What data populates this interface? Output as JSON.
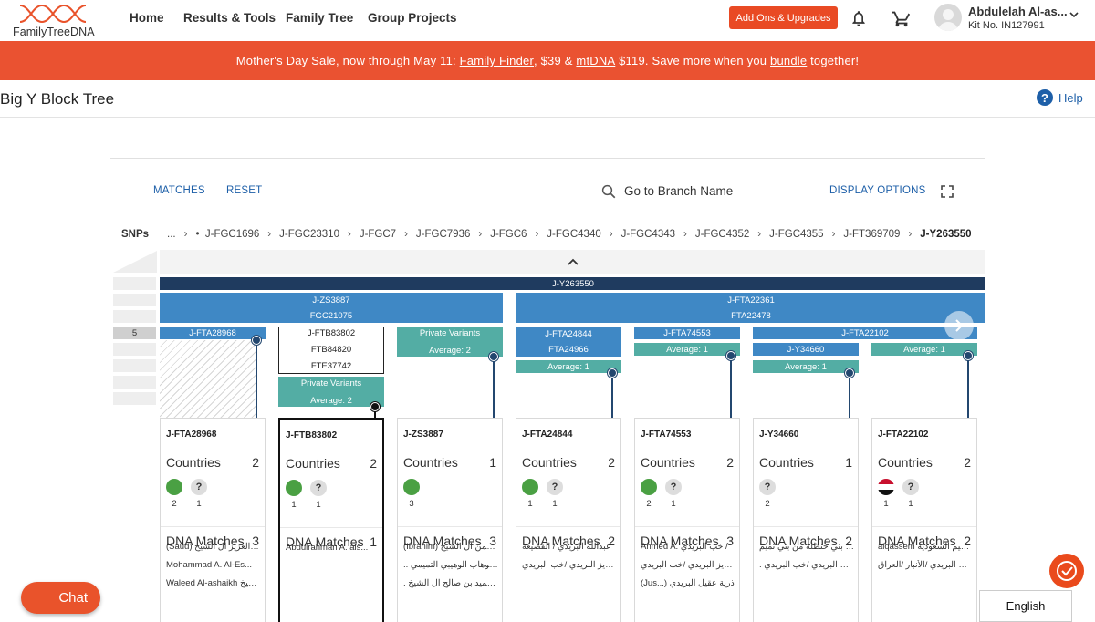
{
  "header": {
    "logo_text": "FamilyTreeDNA",
    "nav": [
      "Home",
      "Results & Tools",
      "Family Tree",
      "Group Projects"
    ],
    "addons_label": "Add Ons & Upgrades",
    "user_name": "Abdulelah Al-as...",
    "user_kit": "Kit No. IN127991"
  },
  "banner": {
    "prefix": "Mother's Day Sale, now through May 11: ",
    "link1": "Family Finder",
    "mid1": ", $39 & ",
    "link2": "mtDNA",
    "mid2": " $119. Save more when you ",
    "link3": "bundle",
    "suffix": " together!"
  },
  "page": {
    "title": "Big Y Block Tree",
    "help_label": "Help"
  },
  "toolbar": {
    "matches_label": "MATCHES",
    "reset_label": "RESET",
    "search_value": "Go to Branch Name",
    "display_options_label": "DISPLAY OPTIONS"
  },
  "breadcrumb": {
    "label": "SNPs",
    "lead": "...",
    "items": [
      "J-FGC1696",
      "J-FGC23310",
      "J-FGC7",
      "J-FGC7936",
      "J-FGC6",
      "J-FGC4340",
      "J-FGC4343",
      "J-FGC4352",
      "J-FGC4355",
      "J-FT369709",
      "J-Y263550"
    ]
  },
  "tree": {
    "side_level": "5",
    "root": "J-Y263550",
    "zs3887": {
      "name": "J-ZS3887",
      "alias": "FGC21075"
    },
    "fta22361": {
      "name": "J-FTA22361",
      "alias": "FTA22478"
    },
    "fta28968": "J-FTA28968",
    "ftb83802": {
      "name": "J-FTB83802",
      "alias1": "FTB84820",
      "alias2": "FTE37742"
    },
    "private_label": "Private Variants",
    "avg2": "Average: 2",
    "avg1": "Average: 1",
    "fta24844": {
      "name": "J-FTA24844",
      "alias": "FTA24966"
    },
    "fta74553": "J-FTA74553",
    "fta22102": "J-FTA22102",
    "y34660": "J-Y34660"
  },
  "cards_labels": {
    "countries": "Countries",
    "dna_matches": "DNA Matches",
    "unknown_flag": "?"
  },
  "cards": [
    {
      "title": "J-FTA28968",
      "countries": "2",
      "flags": [
        {
          "type": "sa",
          "count": "2"
        },
        {
          "type": "q",
          "count": "1"
        }
      ],
      "dna": "3",
      "matches": [
        "(Saud) عبدالعزيز ال الشيخ",
        "Mohammad A. Al-Es...",
        "Waleed Al-ashaikh وليد الشيخ"
      ]
    },
    {
      "title": "J-FTB83802",
      "countries": "2",
      "flags": [
        {
          "type": "sa",
          "count": "1"
        },
        {
          "type": "q",
          "count": "1"
        }
      ],
      "dna": "1",
      "matches": [
        "Abdulrahman A. als..."
      ]
    },
    {
      "title": "J-ZS3887",
      "countries": "1",
      "flags": [
        {
          "type": "sa",
          "count": "3"
        }
      ],
      "dna": "3",
      "matches": [
        "(Ibrahim) عبدالرحمن ال الشيخ",
        ".. عبدالوهاب الوهيبي التميمي",
        ". عبدالحميد بن صالح ال الشيخ"
      ]
    },
    {
      "title": "J-FTA24844",
      "countries": "2",
      "flags": [
        {
          "type": "sa",
          "count": "1"
        },
        {
          "type": "q",
          "count": "1"
        }
      ],
      "dna": "2",
      "matches": [
        "عبدالله البريدي / القصيعة",
        "عبدالعزيز البريدي /خب البريدي"
      ]
    },
    {
      "title": "J-FTA74553",
      "countries": "2",
      "flags": [
        {
          "type": "sa",
          "count": "2"
        },
        {
          "type": "q",
          "count": "1"
        }
      ],
      "dna": "3",
      "matches": [
        "Ahmed A. خب البريدي /",
        "عبدالعزيز البريدي /خب البريدي",
        "(Jus...) ذرية عقيل البريدي"
      ]
    },
    {
      "title": "J-Y34660",
      "countries": "1",
      "flags": [
        {
          "type": "q",
          "count": "2"
        }
      ],
      "dna": "2",
      "matches": [
        "عبدالرحمن بني حنظلة من بني تميم",
        ". عطي البريدي /خب البريدي"
      ]
    },
    {
      "title": "J-FTA22102",
      "countries": "2",
      "flags": [
        {
          "type": "iq",
          "count": "1"
        },
        {
          "type": "q",
          "count": "1"
        }
      ],
      "dna": "2",
      "matches": [
        "alqassem القصيم السعودية",
        "عطي البريدي /الأنبار /العراق"
      ]
    }
  ],
  "widgets": {
    "chat_label": "Chat",
    "language": "English"
  },
  "colors": {
    "brand_orange": "#ea5231",
    "nav_dark": "#1f3b5f",
    "branch_blue": "#3f88c5",
    "variant_teal": "#53ada4",
    "link_blue": "#1d5fa8"
  }
}
